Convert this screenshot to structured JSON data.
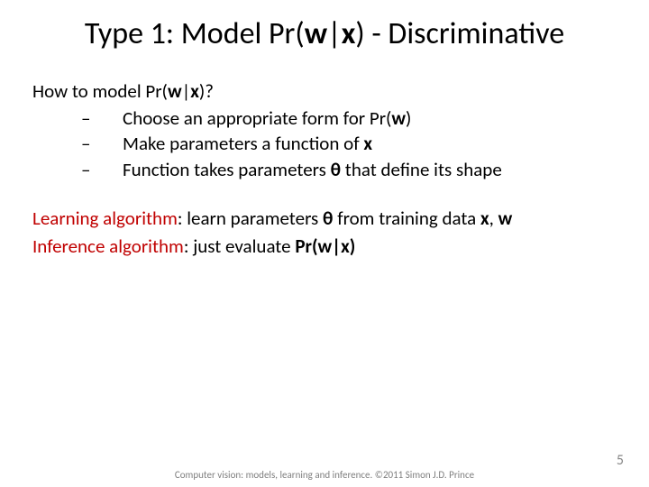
{
  "title": {
    "pre": "Type 1:  Model Pr(",
    "w": "w",
    "mid": "|",
    "x": "x",
    "post": ")  - Discriminative"
  },
  "question": {
    "pre": "How to model Pr(",
    "w": "w",
    "mid": "|",
    "x": "x",
    "post": ")?"
  },
  "bullets": [
    {
      "pre": "Choose an appropriate form for Pr(",
      "b1": "w",
      "post": ")"
    },
    {
      "pre": "Make parameters a function of ",
      "b1": "x",
      "post": ""
    },
    {
      "pre": "Function takes parameters ",
      "b1": "θ",
      "post": " that define its shape"
    }
  ],
  "learn": {
    "label": "Learning algorithm",
    "pre": ":  learn parameters ",
    "theta": "θ",
    "mid": " from training data ",
    "x": "x",
    "comma": ", ",
    "w": "w"
  },
  "infer": {
    "label": "Inference algorithm",
    "pre": ":  just evaluate ",
    "expr": "Pr(w|x)"
  },
  "dash": "–",
  "footer": "Computer vision: models, learning and inference.  ©2011 Simon J.D. Prince",
  "page": "5"
}
